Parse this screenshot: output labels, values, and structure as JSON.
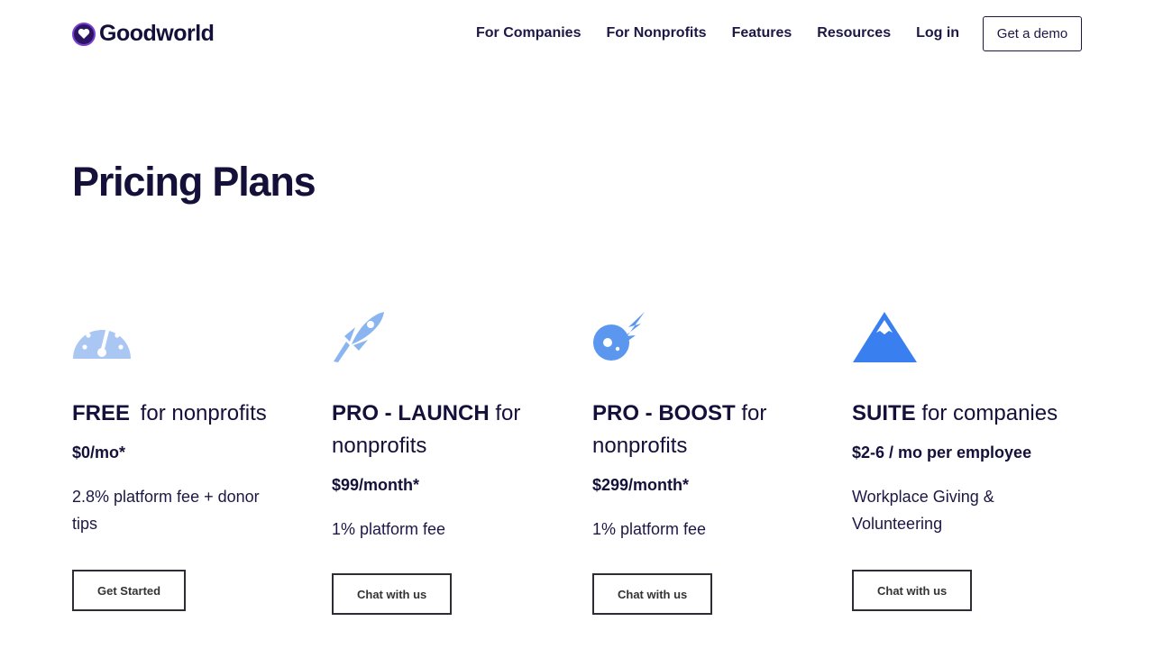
{
  "header": {
    "logo_text": "Goodworld",
    "nav": [
      "For Companies",
      "For Nonprofits",
      "Features",
      "Resources",
      "Log in"
    ],
    "demo_label": "Get a demo"
  },
  "page": {
    "title": "Pricing Plans"
  },
  "plans": [
    {
      "name": "FREE",
      "suffix": " for nonprofits",
      "price": "$0/mo*",
      "desc": "2.8% platform fee + donor tips",
      "button": "Get Started",
      "icon": "speedometer-icon",
      "color": "#a9c7f2"
    },
    {
      "name": "PRO - LAUNCH",
      "suffix": " for nonprofits",
      "price": "$99/month*",
      "desc": "1% platform fee",
      "button": "Chat with us",
      "icon": "rocket-icon",
      "color": "#8ab5f0"
    },
    {
      "name": "PRO - BOOST",
      "suffix": " for nonprofits",
      "price": "$299/month*",
      "desc": "1% platform fee",
      "button": "Chat with us",
      "icon": "comet-icon",
      "color": "#5b97ee"
    },
    {
      "name": "SUITE",
      "suffix": " for companies",
      "price": "$2-6 / mo per employee",
      "desc": "Workplace Giving & Volunteering",
      "button": "Chat with us",
      "icon": "mountain-icon",
      "color": "#3a7ff0"
    }
  ]
}
